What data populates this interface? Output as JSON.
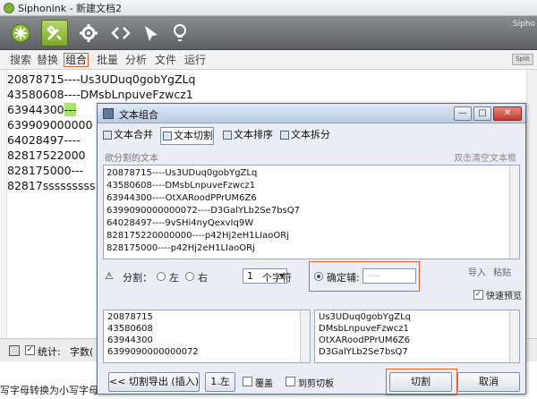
{
  "window": {
    "title": "Siphonink - 新建文档2",
    "brand": "Sipho"
  },
  "menus": [
    "搜索",
    "替换",
    "组合",
    "批量",
    "分析",
    "文件",
    "运行"
  ],
  "menu_active_index": 2,
  "mini_button": "Split",
  "editor_lines": [
    "20878715----Us3UDuq0gobYgZLq",
    "43580608----DMsbLnpuveFzwcz1",
    "63944300",
    "639909000000",
    "64028497----",
    "82817522000",
    "828175000---",
    "82817sssssssss"
  ],
  "editor_hl_text": "---",
  "status": {
    "label": "统计:",
    "chars": "字数("
  },
  "caption": "写字母转换为小写字母",
  "dialog": {
    "title": "文本组合",
    "tabs": [
      "文本合并",
      "文本切割",
      "文本排序",
      "文本拆分"
    ],
    "active_tab": 1,
    "src_title": "欲分割的文本",
    "clear_hint": "双击清空文本框",
    "source_lines": [
      "20878715----Us3UDuq0gobYgZLq",
      "43580608----DMsbLnpuveFzwcz1",
      "63944300----OtXARoodPPrUM6Z6",
      "6399090000000072----D3GalYLb2Se7bsQ7",
      "64028497----9vSHi4nyQexvIq9W",
      "828175220000000----p42Hj2eH1LIaoORj",
      "828175000----p42Hj2eH1LIaoORj"
    ],
    "split_label": "分割：",
    "left_label": "左",
    "right_label": "右",
    "count_value": "1",
    "chars_unit": "个字符",
    "sep_label": "确定辅:",
    "sep_placeholder": "----",
    "import_label": "导入",
    "paste_label": "粘贴",
    "preview_label": "快速预览",
    "left_results": [
      "20878715",
      "43580608",
      "63944300",
      "6399090000000072"
    ],
    "right_results": [
      "Us3UDuq0gobYgZLq",
      "DMsbLnpuveFzwcz1",
      "OtXARoodPPrUM6Z6",
      "D3GalYLb2Se7bsQ7"
    ],
    "export_button": "<< 切割导出 (插入)",
    "export_option": "1.左",
    "overwrite_label": "覆盖",
    "clipboard_label": "到剪切板",
    "cut_button": "切割",
    "cancel_button": "取消"
  },
  "colors": {
    "accent_highlight": "#e0602d",
    "editor_highlight": "#a8e36a",
    "toolbar_green": "#8fbf3e"
  }
}
